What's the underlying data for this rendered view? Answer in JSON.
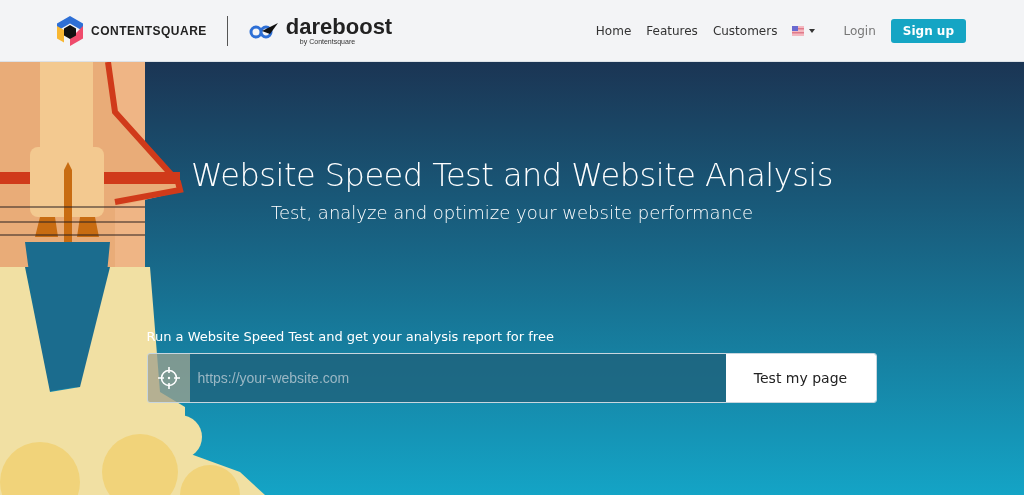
{
  "header": {
    "brand": "CONTENTSQUARE",
    "product": "dareboost",
    "product_tagline": "by Contentsquare"
  },
  "nav": [
    {
      "label": "Home"
    },
    {
      "label": "Features"
    },
    {
      "label": "Customers"
    }
  ],
  "login": "Login",
  "signup": "Sign up",
  "hero": {
    "title": "Website Speed Test and Website Analysis",
    "subtitle": "Test, analyze and optimize your website performance"
  },
  "form": {
    "label": "Run a Website Speed Test and get your analysis report for free",
    "placeholder": "https://your-website.com",
    "button": "Test my page"
  }
}
